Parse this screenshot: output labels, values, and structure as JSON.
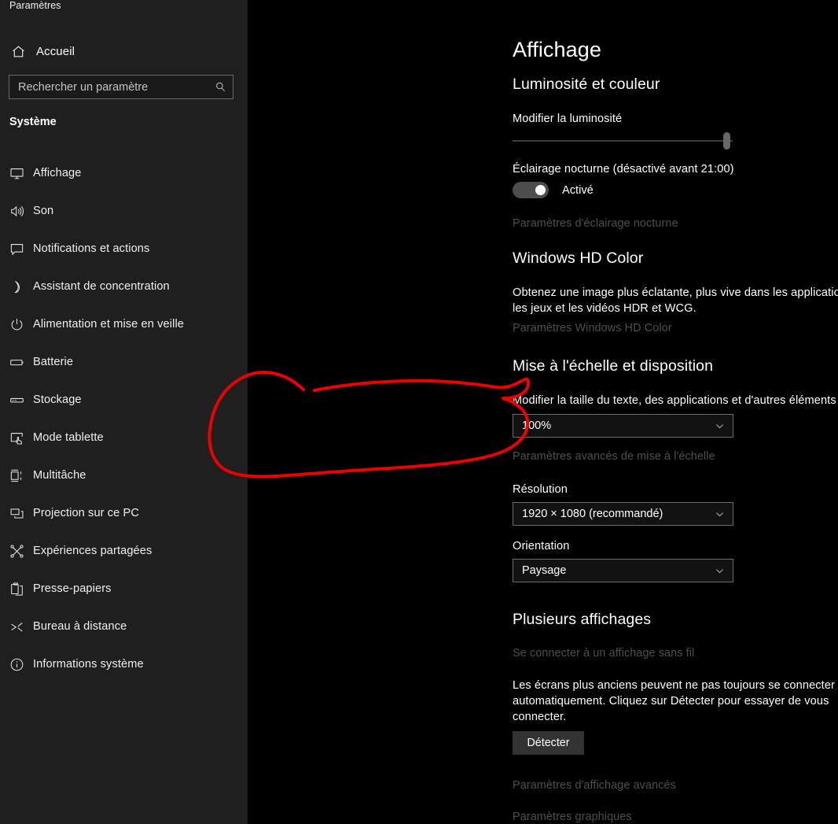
{
  "window": {
    "app_title": "Paramètres",
    "background_color": "#000000",
    "sidebar_color": "#1f1f1f"
  },
  "sidebar": {
    "home": {
      "label": "Accueil",
      "icon": "home-icon"
    },
    "search": {
      "placeholder": "Rechercher un paramètre",
      "value": "",
      "icon": "search-icon"
    },
    "group_title": "Système",
    "items": [
      {
        "label": "Affichage",
        "icon": "monitor-icon",
        "selected": true
      },
      {
        "label": "Son",
        "icon": "speaker-icon",
        "selected": false
      },
      {
        "label": "Notifications et actions",
        "icon": "notification-icon",
        "selected": false
      },
      {
        "label": "Assistant de concentration",
        "icon": "moon-icon",
        "selected": false
      },
      {
        "label": "Alimentation et mise en veille",
        "icon": "power-icon",
        "selected": false
      },
      {
        "label": "Batterie",
        "icon": "battery-icon",
        "selected": false
      },
      {
        "label": "Stockage",
        "icon": "storage-icon",
        "selected": false
      },
      {
        "label": "Mode tablette",
        "icon": "tablet-mode-icon",
        "selected": false
      },
      {
        "label": "Multitâche",
        "icon": "multitasking-icon",
        "selected": false
      },
      {
        "label": "Projection sur ce PC",
        "icon": "projection-icon",
        "selected": false
      },
      {
        "label": "Expériences partagées",
        "icon": "shared-experiences-icon",
        "selected": false
      },
      {
        "label": "Presse-papiers",
        "icon": "clipboard-icon",
        "selected": false
      },
      {
        "label": "Bureau à distance",
        "icon": "remote-desktop-icon",
        "selected": false
      },
      {
        "label": "Informations système",
        "icon": "info-icon",
        "selected": false
      }
    ]
  },
  "main": {
    "page_title": "Affichage",
    "brightness": {
      "heading": "Luminosité et couleur",
      "slider_label": "Modifier la luminosité",
      "slider_value": 96,
      "night_light_label": "Éclairage nocturne (désactivé avant 21:00)",
      "night_light_state": "Activé",
      "night_light_on": true,
      "night_light_link": "Paramètres d'éclairage nocturne"
    },
    "hd_color": {
      "heading": "Windows HD Color",
      "description": "Obtenez une image plus éclatante, plus vive dans les applications, les jeux et les vidéos HDR et WCG.",
      "link": "Paramètres Windows HD Color"
    },
    "scaling": {
      "heading": "Mise à l'échelle et disposition",
      "scale_label": "Modifier la taille du texte, des applications et d'autres éléments",
      "scale_value": "100%",
      "advanced_link": "Paramètres avancés de mise à l'échelle",
      "resolution_label": "Résolution",
      "resolution_value": "1920 × 1080 (recommandé)",
      "orientation_label": "Orientation",
      "orientation_value": "Paysage"
    },
    "multiple_displays": {
      "heading": "Plusieurs affichages",
      "wireless_link": "Se connecter à un affichage sans fil",
      "description": "Les écrans plus anciens peuvent ne pas toujours se connecter automatiquement. Cliquez sur Détecter pour essayer de vous connecter.",
      "detect_button": "Détecter"
    },
    "footer_links": [
      "Paramètres d'affichage avancés",
      "Paramètres graphiques"
    ]
  },
  "annotation": {
    "type": "hand-drawn-ellipse",
    "color": "#ee0000",
    "stroke_width": 4,
    "targets": [
      "scale_label",
      "scale_value",
      "advanced_link"
    ]
  }
}
